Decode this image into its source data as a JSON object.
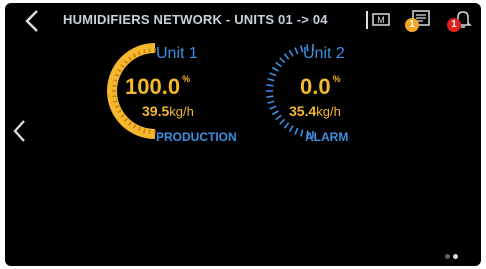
{
  "header": {
    "title": "HUMIDIFIERS NETWORK - UNITS 01 -> 04",
    "back_icon": "chevron-left-icon",
    "actions": [
      {
        "name": "manual-mode-icon",
        "label": "M"
      },
      {
        "name": "messages-icon",
        "badge": "1",
        "badge_color": "#f5a623"
      },
      {
        "name": "alarm-bell-icon",
        "badge": "1",
        "badge_color": "#e02020"
      }
    ]
  },
  "units": [
    {
      "name": "Unit 1",
      "percent": "100.0",
      "percent_unit": "%",
      "flow": "39.5",
      "flow_unit": "kg/h",
      "status": "PRODUCTION",
      "level": 1.0
    },
    {
      "name": "Unit 2",
      "percent": "0.0",
      "percent_unit": "%",
      "flow": "35.4",
      "flow_unit": "kg/h",
      "status": "ALARM",
      "level": 0.0
    }
  ],
  "pager": {
    "pages": 2,
    "current": 2
  },
  "colors": {
    "accent_blue": "#3d8fe0",
    "value_amber": "#f5b72c",
    "background": "#000000"
  }
}
